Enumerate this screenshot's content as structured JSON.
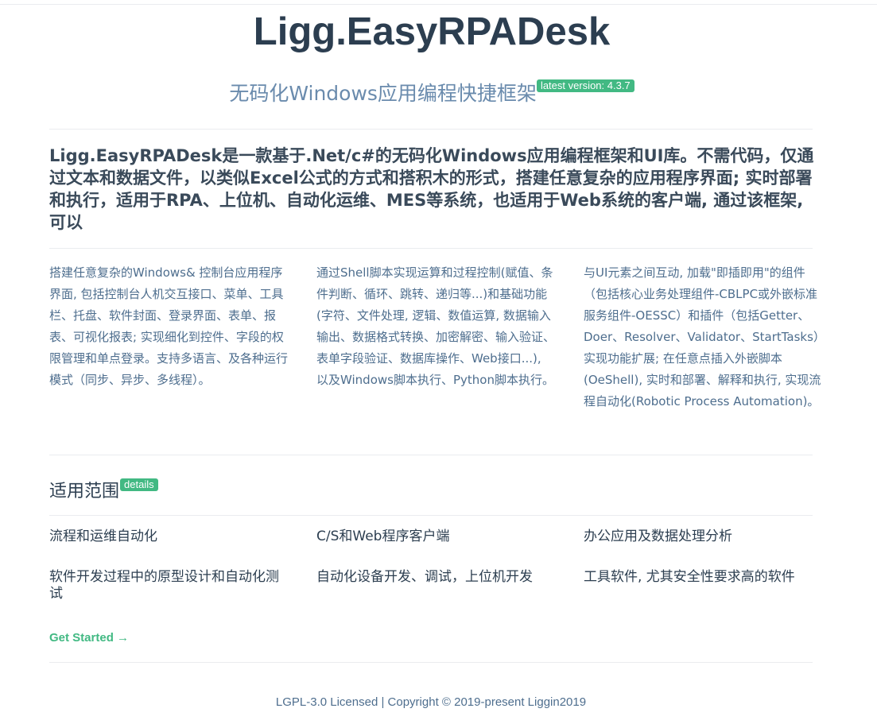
{
  "hero": {
    "title": "Ligg.EasyRPADesk",
    "description": "无码化Windows应用编程快捷框架",
    "version_badge": "latest version: 4.3.7"
  },
  "intro": {
    "text": "Ligg.EasyRPADesk是一款基于.Net/c#的无码化Windows应用编程框架和UI库。不需代码，仅通过文本和数据文件，以类似Excel公式的方式和搭积木的形式，搭建任意复杂的应用程序界面; 实时部署和执行，适用于RPA、上位机、自动化运维、MES等系统，也适用于Web系统的客户端, 通过该框架, 可以"
  },
  "features": [
    {
      "text": "搭建任意复杂的Windows& 控制台应用程序界面, 包括控制台人机交互接口、菜单、工具栏、托盘、软件封面、登录界面、表单、报表、可视化报表; 实现细化到控件、字段的权限管理和单点登录。支持多语言、及各种运行模式（同步、异步、多线程）。"
    },
    {
      "text": "通过Shell脚本实现运算和过程控制(赋值、条件判断、循环、跳转、递归等...)和基础功能(字符、文件处理, 逻辑、数值运算, 数据输入输出、数据格式转换、加密解密、输入验证、表单字段验证、数据库操作、Web接口...), 以及Windows脚本执行、Python脚本执行。"
    },
    {
      "text": "与UI元素之间互动, 加载\"即插即用\"的组件（包括核心业务处理组件-CBLPC或外嵌标准服务组件-OESSC）和插件（包括Getter、Doer、Resolver、Validator、StartTasks）实现功能扩展; 在任意点插入外嵌脚本(OeShell), 实时和部署、解释和执行, 实现流程自动化(Robotic Process Automation)。"
    }
  ],
  "scope": {
    "title": "适用范围",
    "badge": "details",
    "items": [
      "流程和运维自动化",
      "C/S和Web程序客户端",
      "办公应用及数据处理分析",
      "软件开发过程中的原型设计和自动化测试",
      "自动化设备开发、调试，上位机开发",
      "工具软件, 尤其安全性要求高的软件"
    ]
  },
  "get_started": "Get Started →",
  "footer": "LGPL-3.0 Licensed | Copyright © 2019-present Liggin2019",
  "colors": {
    "accent": "#42b983",
    "text": "#2c3e50",
    "muted": "#6a8bad",
    "divider": "#eaecef"
  }
}
